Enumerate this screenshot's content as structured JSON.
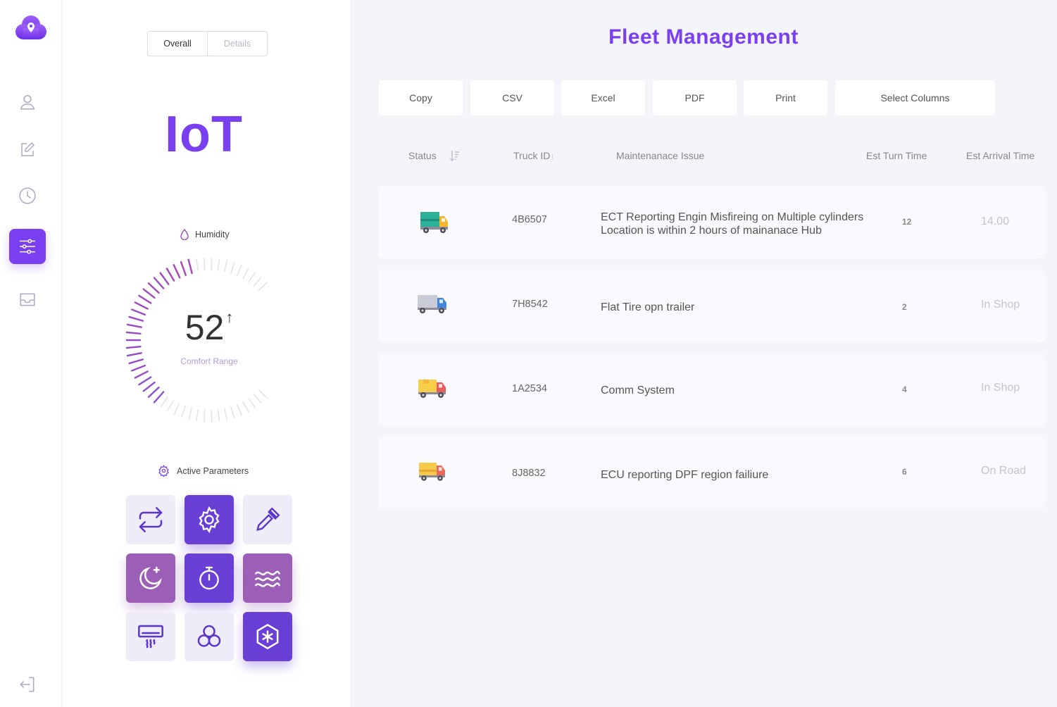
{
  "panel": {
    "tabs": [
      {
        "label": "Overall"
      },
      {
        "label": "Details"
      }
    ],
    "title": "IoT",
    "humidity": {
      "label": "Humidity",
      "value": "52",
      "subtitle": "Comfort Range"
    },
    "active_parameters_label": "Active Parameters"
  },
  "main": {
    "title": "Fleet Management",
    "toolbar": [
      "Copy",
      "CSV",
      "Excel",
      "PDF",
      "Print",
      "Select Columns"
    ],
    "columns": {
      "status": "Status",
      "truck_id": "Truck ID",
      "issue": "Maintenanace Issue",
      "turn": "Est Turn Time",
      "arrival": "Est Arrival Time"
    },
    "rows": [
      {
        "truck_id": "4B6507",
        "issue_line1": "ECT Reporting Engin Misfireing on Multiple cylinders",
        "issue_line2": "Location is within 2 hours of mainanace Hub",
        "turn": "12",
        "arrival": "14.00",
        "icon": "truck-green-icon"
      },
      {
        "truck_id": "7H8542",
        "issue_line1": "Flat Tire opn trailer",
        "issue_line2": "",
        "turn": "2",
        "arrival": "In Shop",
        "icon": "truck-blue-icon"
      },
      {
        "truck_id": "1A2534",
        "issue_line1": "Comm System",
        "issue_line2": "",
        "turn": "4",
        "arrival": "In Shop",
        "icon": "truck-yellow-icon"
      },
      {
        "truck_id": "8J8832",
        "issue_line1": "ECU reporting DPF region failiure",
        "issue_line2": "",
        "turn": "6",
        "arrival": "On Road",
        "icon": "truck-orange-icon"
      }
    ]
  },
  "colors": {
    "accent": "#7b3ff2",
    "tile_dark": "#6a3fd6",
    "tile_mauve": "#9b5fb8",
    "tile_light": "#efecfa"
  },
  "icons": {
    "rail": [
      "cloud-pin-logo-icon",
      "user-icon",
      "edit-icon",
      "clock-icon",
      "sliders-icon",
      "inbox-icon",
      "logout-icon"
    ],
    "parameters": [
      "repeat-icon",
      "settings-icon",
      "pipette-icon",
      "moon-icon",
      "timer-icon",
      "waves-icon",
      "air-conditioner-icon",
      "fan-icon",
      "snowflake-icon"
    ]
  }
}
